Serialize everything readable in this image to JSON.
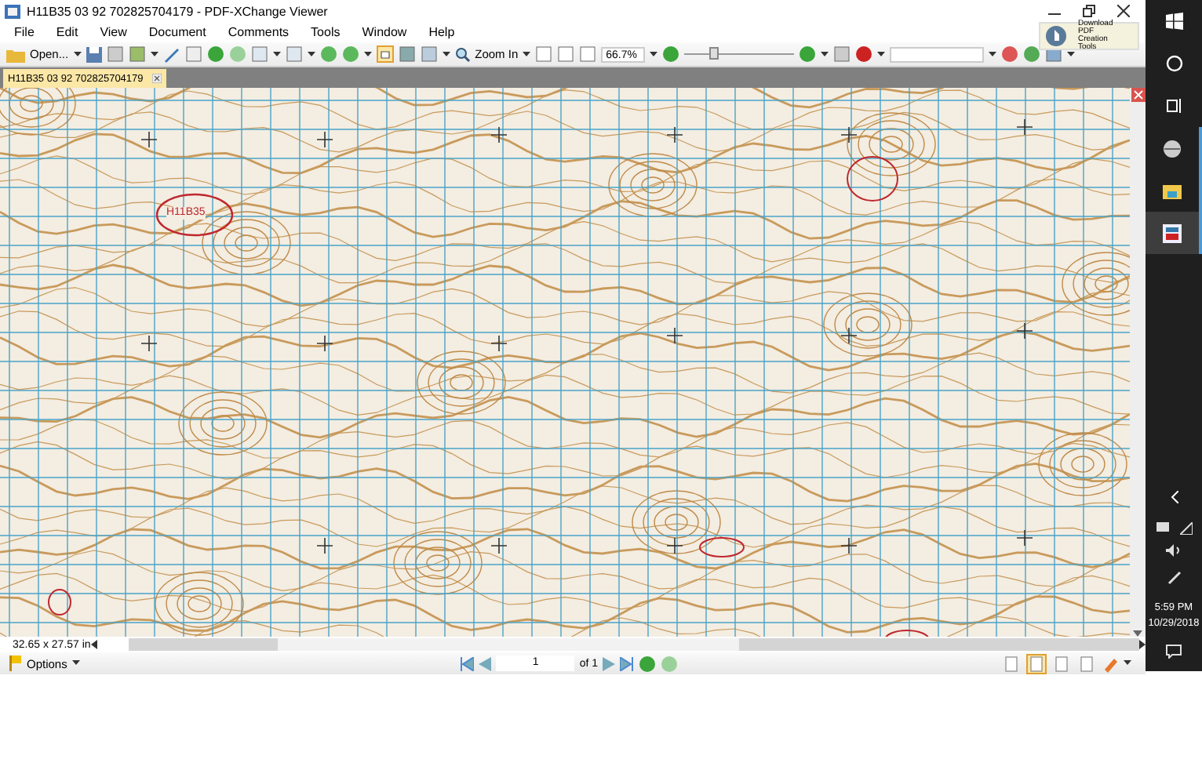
{
  "window": {
    "title": "H11B35 03 92 702825704179 - PDF-XChange Viewer"
  },
  "menu": [
    "File",
    "Edit",
    "View",
    "Document",
    "Comments",
    "Tools",
    "Window",
    "Help"
  ],
  "promo": {
    "label": "Download PDF Creation Tools"
  },
  "toolbar": {
    "open_label": "Open...",
    "zoom_label": "Zoom In",
    "zoom_value": "66.7%",
    "zoom_slider": {
      "level": 0.25
    }
  },
  "tabs": [
    {
      "label": "H11B35 03 92 702825704179",
      "selected": true
    }
  ],
  "map": {
    "annotations": [
      {
        "label": "H11B35"
      }
    ]
  },
  "status": {
    "page_size": "32.65 x 27.57 in",
    "options_label": "Options",
    "page": "1",
    "page_count": "of 1"
  },
  "view_modes": [
    {
      "selected": false
    },
    {
      "selected": true
    },
    {
      "selected": false
    },
    {
      "selected": false
    }
  ],
  "taskbar": {
    "apps": [
      {
        "selected": false
      },
      {
        "selected": false
      },
      {
        "selected": true
      }
    ],
    "time": "5:59 PM",
    "date": "10/29/2018"
  }
}
